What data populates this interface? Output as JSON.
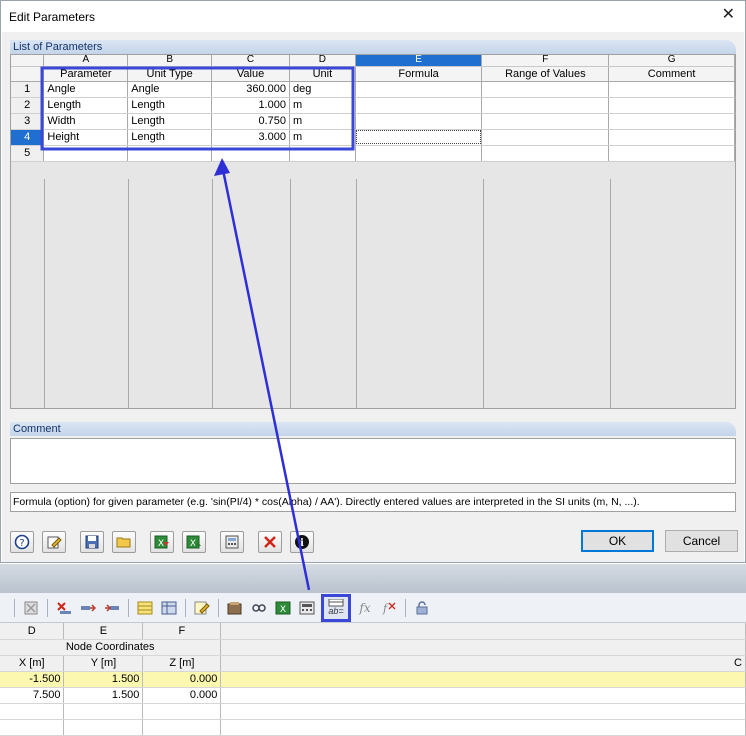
{
  "window": {
    "title": "Edit Parameters",
    "close_glyph": "✕"
  },
  "list_section": {
    "label": "List of Parameters"
  },
  "grid": {
    "column_letters": [
      "A",
      "B",
      "C",
      "D",
      "E",
      "F",
      "G"
    ],
    "column_names": [
      "Parameter",
      "Unit Type",
      "Value",
      "Unit",
      "Formula",
      "Range of Values",
      "Comment"
    ],
    "selected_column": "E",
    "rows": [
      {
        "num": "1",
        "parameter": "Angle",
        "unit_type": "Angle",
        "value": "360.000",
        "unit": "deg",
        "formula": "",
        "range": "",
        "comment": ""
      },
      {
        "num": "2",
        "parameter": "Length",
        "unit_type": "Length",
        "value": "1.000",
        "unit": "m",
        "formula": "",
        "range": "",
        "comment": ""
      },
      {
        "num": "3",
        "parameter": "Width",
        "unit_type": "Length",
        "value": "0.750",
        "unit": "m",
        "formula": "",
        "range": "",
        "comment": ""
      },
      {
        "num": "4",
        "parameter": "Height",
        "unit_type": "Length",
        "value": "3.000",
        "unit": "m",
        "formula": "",
        "range": "",
        "comment": ""
      },
      {
        "num": "5",
        "parameter": "",
        "unit_type": "",
        "value": "",
        "unit": "",
        "formula": "",
        "range": "",
        "comment": ""
      }
    ],
    "selected_row": "4"
  },
  "comment_section": {
    "label": "Comment",
    "value": ""
  },
  "status_text": "Formula (option) for given parameter (e.g. 'sin(PI/4) * cos(Alpha) / AA'). Directly entered values are interpreted in the SI units (m, N, ...).",
  "dialog_buttons": {
    "icons": [
      "help-icon",
      "edit-icon",
      "save-icon",
      "open-folder-icon",
      "import-excel-icon",
      "export-excel-icon",
      "calculator-icon",
      "delete-icon",
      "info-icon"
    ],
    "ok_label": "OK",
    "cancel_label": "Cancel"
  },
  "main_toolbar": {
    "icons": [
      "delete-icon",
      "delete-row-icon",
      "insert-row-icon",
      "table-icon",
      "table-grid-icon",
      "edit-table-icon",
      "filter-icon",
      "link-icon",
      "excel-icon",
      "calculator-icon",
      "parameter-formula-icon",
      "fx-icon",
      "fx-remove-icon",
      "lock-icon"
    ],
    "highlighted_button_glyph": "ab="
  },
  "node_table": {
    "column_letters": [
      "D",
      "E",
      "F"
    ],
    "group_header": "Node Coordinates",
    "column_names": [
      "X [m]",
      "Y [m]",
      "Z [m]"
    ],
    "rows": [
      {
        "x": "-1.500",
        "y": "1.500",
        "z": "0.000"
      },
      {
        "x": "7.500",
        "y": "1.500",
        "z": "0.000"
      }
    ],
    "trailing_letter": "C"
  },
  "annotation": {
    "color": "#2f2fd8",
    "highlight_color": "#3b47d9"
  }
}
